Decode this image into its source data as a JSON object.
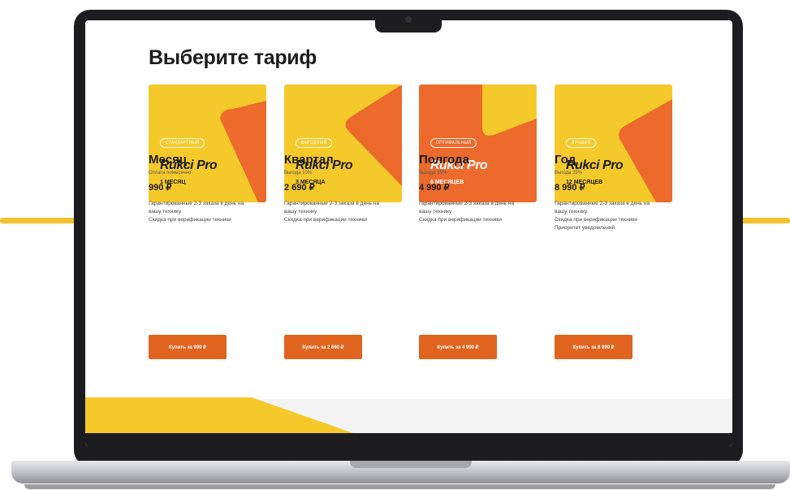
{
  "page": {
    "title": "Выберите тариф"
  },
  "plans": [
    {
      "badge": "стандартный",
      "brand": "Rukci Pro",
      "period": "1 МЕСЯЦ",
      "name": "Месяц",
      "note": "Оплата помесячно",
      "price": "990 ₽",
      "features": [
        "Гарантированные 2-3 заказа в день на",
        "вашу технику",
        "Скидка при верификации техники"
      ],
      "button": "Купить за 990 ₽"
    },
    {
      "badge": "выгодный",
      "brand": "Rukci Pro",
      "period": "3 МЕСЯЦА",
      "name": "Квартал",
      "note": "Выгода 10%",
      "price": "2 690 ₽",
      "features": [
        "Гарантированные 2-3 заказа в день на",
        "вашу технику",
        "Скидка при верификации техники"
      ],
      "button": "Купить за 2 690 ₽"
    },
    {
      "badge": "оптимальный",
      "brand": "Rukci Pro",
      "period": "6 МЕСЯЦЕВ",
      "name": "Полгода",
      "note": "Выгода 15%",
      "price": "4 990 ₽",
      "features": [
        "Гарантированные 2-3 заказа в день на",
        "вашу технику",
        "Скидка при верификации техники"
      ],
      "button": "Купить за 4 990 ₽"
    },
    {
      "badge": "лучший",
      "brand": "Rukci Pro",
      "period": "12 МЕСЯЦЕВ",
      "name": "Год",
      "note": "Выгода 25%",
      "price": "8 990 ₽",
      "features": [
        "Гарантированные 2-3 заказа в день на",
        "вашу технику",
        "Скидка при верификации техники",
        "Приоритет уведомлений"
      ],
      "button": "Купить за 8 990 ₽"
    }
  ],
  "colors": {
    "yellow": "#f6c92a",
    "orange": "#ec6a2b",
    "button": "#e0641f",
    "text": "#1c1c1c"
  }
}
